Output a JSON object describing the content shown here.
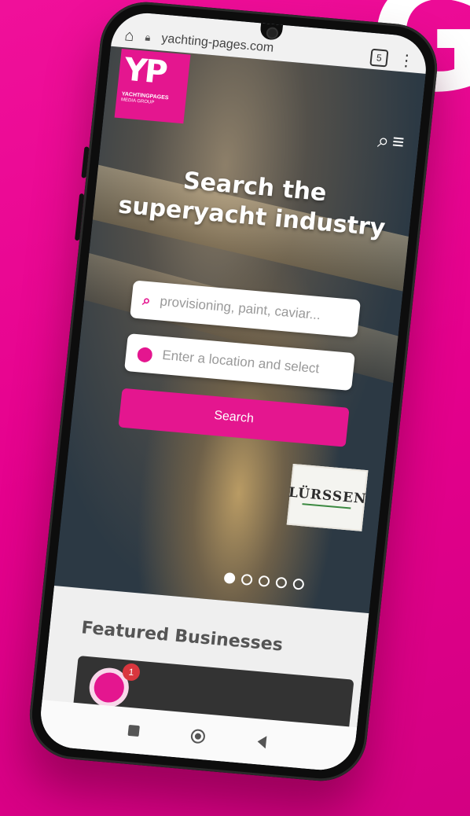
{
  "browser": {
    "url": "yachting-pages.com",
    "tab_count": "5"
  },
  "logo": {
    "mark": "YP",
    "line1": "YACHTINGPAGES",
    "line2": "MEDIA GROUP"
  },
  "hero": {
    "headline_line1": "Search the",
    "headline_line2": "superyacht industry"
  },
  "search": {
    "keyword_placeholder": "provisioning, paint, caviar...",
    "location_placeholder": "Enter a location and select",
    "button_label": "Search"
  },
  "advert": {
    "brand": "LÜRSSEN"
  },
  "carousel": {
    "slides": 5,
    "active": 1
  },
  "featured": {
    "title": "Featured Businesses",
    "notification_count": "1"
  },
  "background_letter": "G",
  "colors": {
    "brand_pink": "#e4168f",
    "background": "#e4008c"
  },
  "icons": [
    "home-icon",
    "lock-icon",
    "tabs-icon",
    "more-icon",
    "search-icon",
    "menu-icon",
    "map-pin-icon",
    "nav-recents-icon",
    "nav-home-icon",
    "nav-back-icon"
  ]
}
